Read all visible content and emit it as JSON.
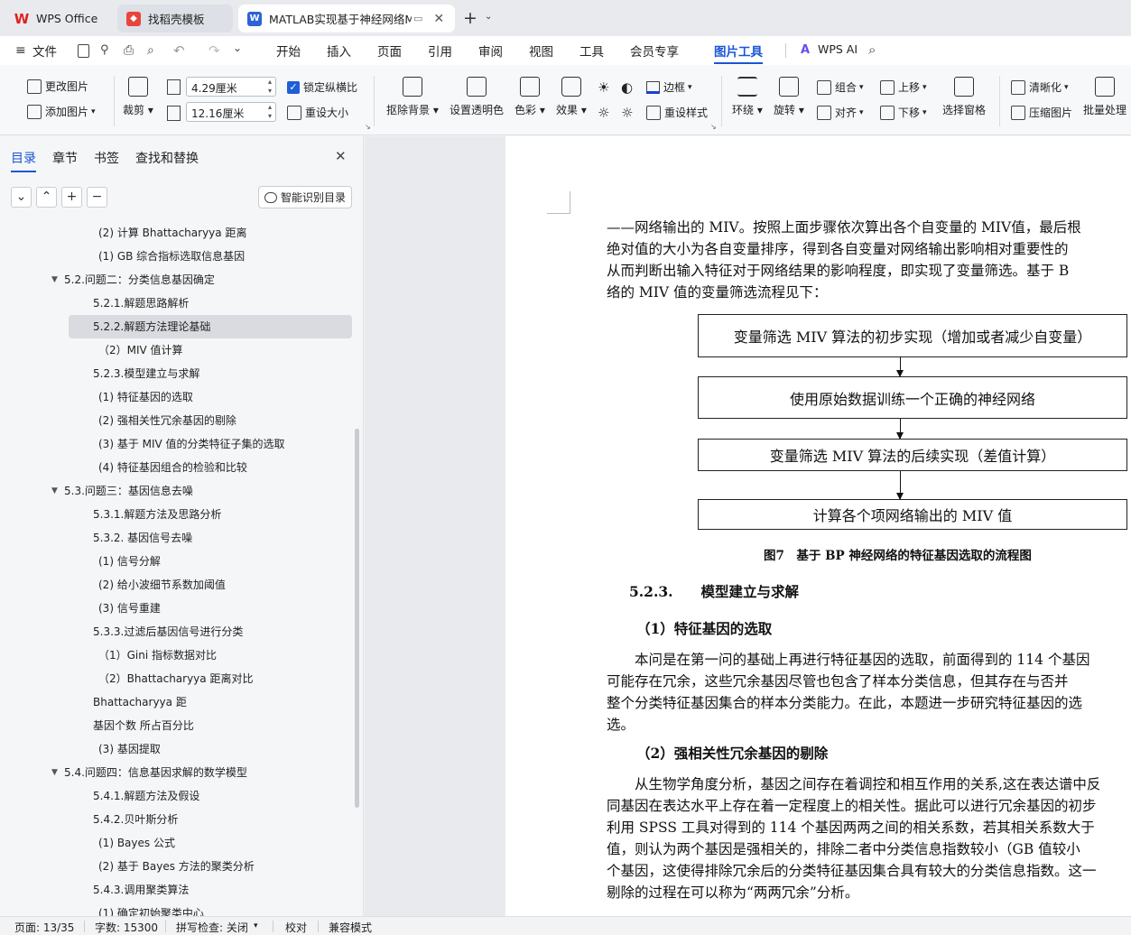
{
  "tabs": [
    {
      "label": "WPS Office",
      "icon": "wps-logo-icon"
    },
    {
      "label": "找稻壳模板",
      "icon": "docer-icon"
    },
    {
      "label": "MATLAB实现基于神经网络MI",
      "icon": "word-doc-icon"
    }
  ],
  "menu": {
    "file": "文件",
    "items": [
      "开始",
      "插入",
      "页面",
      "引用",
      "审阅",
      "视图",
      "工具",
      "会员专享",
      "图片工具"
    ],
    "ai": "WPS AI"
  },
  "ribbon": {
    "change_image": "更改图片",
    "add_image": "添加图片",
    "crop": "裁剪",
    "width": "4.29厘米",
    "height": "12.16厘米",
    "lock_ratio": "锁定纵横比",
    "reset_size": "重设大小",
    "remove_bg": "抠除背景",
    "set_transparent": "设置透明色",
    "color": "色彩",
    "effect": "效果",
    "border": "边框",
    "reset_style": "重设样式",
    "wrap": "环绕",
    "rotate": "旋转",
    "combine": "组合",
    "align": "对齐",
    "move_up": "上移",
    "move_down": "下移",
    "select_pane": "选择窗格",
    "sharpen": "清晰化",
    "compress": "压缩图片",
    "batch": "批量处理"
  },
  "panel": {
    "tabs": [
      "目录",
      "章节",
      "书签",
      "查找和替换"
    ],
    "smart_toc": "智能识别目录",
    "toc": [
      {
        "text": "(2) 计算 Bhattacharyya 距离",
        "level": 3
      },
      {
        "text": "(1) GB 综合指标选取信息基因",
        "level": 3
      },
      {
        "text": "5.2.问题二：分类信息基因确定",
        "level": 1,
        "expanded": true
      },
      {
        "text": "5.2.1.解题思路解析",
        "level": 2
      },
      {
        "text": "5.2.2.解题方法理论基础",
        "level": 2,
        "selected": true
      },
      {
        "text": "（2）MIV 值计算",
        "level": 3
      },
      {
        "text": "5.2.3.模型建立与求解",
        "level": 2
      },
      {
        "text": "(1) 特征基因的选取",
        "level": 3
      },
      {
        "text": "(2) 强相关性冗余基因的剔除",
        "level": 3
      },
      {
        "text": "(3) 基于 MIV 值的分类特征子集的选取",
        "level": 3
      },
      {
        "text": "(4) 特征基因组合的检验和比较",
        "level": 3
      },
      {
        "text": "5.3.问题三：基因信息去噪",
        "level": 1,
        "expanded": true
      },
      {
        "text": "5.3.1.解题方法及思路分析",
        "level": 2
      },
      {
        "text": "5.3.2. 基因信号去噪",
        "level": 2
      },
      {
        "text": "(1) 信号分解",
        "level": 3
      },
      {
        "text": "(2) 给小波细节系数加阈值",
        "level": 3
      },
      {
        "text": "(3) 信号重建",
        "level": 3
      },
      {
        "text": "5.3.3.过滤后基因信号进行分类",
        "level": 2
      },
      {
        "text": "（1）Gini 指标数据对比",
        "level": 3
      },
      {
        "text": "（2）Bhattacharyya 距离对比",
        "level": 3
      },
      {
        "text": "Bhattacharyya 距",
        "level": 2
      },
      {
        "text": "基因个数 所占百分比",
        "level": 2
      },
      {
        "text": "(3) 基因提取",
        "level": 3
      },
      {
        "text": "5.4.问题四：信息基因求解的数学模型",
        "level": 1,
        "expanded": true
      },
      {
        "text": "5.4.1.解题方法及假设",
        "level": 2
      },
      {
        "text": "5.4.2.贝叶斯分析",
        "level": 2
      },
      {
        "text": "(1) Bayes 公式",
        "level": 3
      },
      {
        "text": "(2) 基于 Bayes 方法的聚类分析",
        "level": 3
      },
      {
        "text": "5.4.3.调用聚类算法",
        "level": 2
      },
      {
        "text": "(1) 确定初始聚类中心",
        "level": 3
      }
    ]
  },
  "doc": {
    "para1": [
      "——网络输出的 MIV。按照上面步骤依次算出各个自变量的 MIV值，最后根",
      "绝对值的大小为各自变量排序，得到各自变量对网络输出影响相对重要性的",
      "从而判断出输入特征对于网络结果的影响程度，即实现了变量筛选。基于 B",
      "络的 MIV 值的变量筛选流程见下："
    ],
    "flow": [
      "变量筛选 MIV 算法的初步实现（增加或者减少自变量）",
      "使用原始数据训练一个正确的神经网络",
      "变量筛选 MIV 算法的后续实现（差值计算）",
      "计算各个项网络输出的 MIV 值"
    ],
    "caption": "图7　基于 BP 神经网络的特征基因选取的流程图",
    "h_523": "5.2.3.　　模型建立与求解",
    "h_1": "（1）特征基因的选取",
    "para2": [
      "本问是在第一问的基础上再进行特征基因的选取，前面得到的 114 个基因",
      "可能存在冗余，这些冗余基因尽管也包含了样本分类信息，但其存在与否并",
      "整个分类特征基因集合的样本分类能力。在此，本题进一步研究特征基因的选",
      "选。"
    ],
    "h_2": "（2）强相关性冗余基因的剔除",
    "para3": [
      "从生物学角度分析，基因之间存在着调控和相互作用的关系,这在表达谱中反",
      "同基因在表达水平上存在着一定程度上的相关性。据此可以进行冗余基因的初步",
      "利用 SPSS 工具对得到的 114 个基因两两之间的相关系数，若其相关系数大于",
      "值，则认为两个基因是强相关的，排除二者中分类信息指数较小（GB 值较小",
      "个基因，这使得排除冗余后的分类特征基因集合具有较大的分类信息指数。这一",
      "剔除的过程在可以称为“两两冗余”分析。"
    ]
  },
  "status": {
    "page": "页面: 13/35",
    "words": "字数: 15300",
    "spell": "拼写检查: 关闭",
    "proof": "校对",
    "compat": "兼容模式"
  }
}
